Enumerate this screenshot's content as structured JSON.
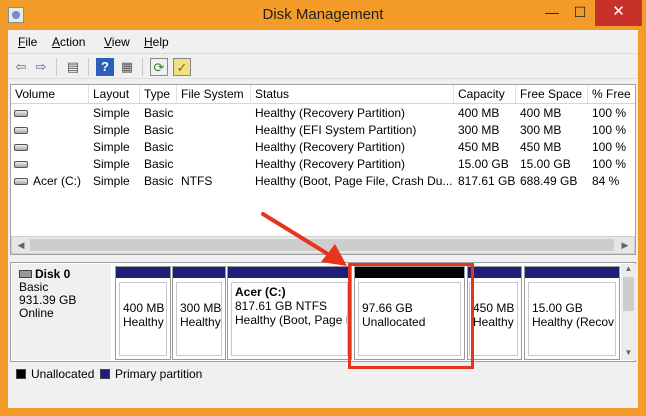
{
  "window": {
    "title": "Disk Management",
    "close_glyph": "✕",
    "max_glyph": "☐",
    "min_glyph": "—"
  },
  "menu": [
    {
      "key": "F",
      "rest": "ile"
    },
    {
      "key": "A",
      "rest": "ction"
    },
    {
      "key": "V",
      "rest": "iew"
    },
    {
      "key": "H",
      "rest": "elp"
    }
  ],
  "toolbar": {
    "back_icon": "back-arrow-icon",
    "forward_icon": "forward-arrow-icon",
    "back_glyph": "⇦",
    "forward_glyph": "⇨",
    "panel_glyph": "▤",
    "help_glyph": "?",
    "props_glyph": "▦",
    "refresh_glyph": "⟳",
    "check_glyph": "✓"
  },
  "columns": [
    "Volume",
    "Layout",
    "Type",
    "File System",
    "Status",
    "Capacity",
    "Free Space",
    "% Free"
  ],
  "volumes": [
    {
      "volume": "",
      "layout": "Simple",
      "type": "Basic",
      "fs": "",
      "status": "Healthy (Recovery Partition)",
      "capacity": "400 MB",
      "free": "400 MB",
      "pct": "100 %"
    },
    {
      "volume": "",
      "layout": "Simple",
      "type": "Basic",
      "fs": "",
      "status": "Healthy (EFI System Partition)",
      "capacity": "300 MB",
      "free": "300 MB",
      "pct": "100 %"
    },
    {
      "volume": "",
      "layout": "Simple",
      "type": "Basic",
      "fs": "",
      "status": "Healthy (Recovery Partition)",
      "capacity": "450 MB",
      "free": "450 MB",
      "pct": "100 %"
    },
    {
      "volume": "",
      "layout": "Simple",
      "type": "Basic",
      "fs": "",
      "status": "Healthy (Recovery Partition)",
      "capacity": "15.00 GB",
      "free": "15.00 GB",
      "pct": "100 %"
    },
    {
      "volume": "Acer (C:)",
      "layout": "Simple",
      "type": "Basic",
      "fs": "NTFS",
      "status": "Healthy (Boot, Page File, Crash Du...",
      "capacity": "817.61 GB",
      "free": "688.49 GB",
      "pct": "84 %"
    }
  ],
  "disk": {
    "name": "Disk 0",
    "type": "Basic",
    "size": "931.39 GB",
    "state": "Online"
  },
  "partitions": [
    {
      "line1": "400 MB",
      "line2": "Healthy",
      "title": "",
      "kind": "primary"
    },
    {
      "line1": "300 MB",
      "line2": "Healthy",
      "title": "",
      "kind": "primary"
    },
    {
      "title": "Acer  (C:)",
      "line1": "817.61 GB NTFS",
      "line2": "Healthy (Boot, Page F",
      "kind": "primary"
    },
    {
      "line1": "97.66 GB",
      "line2": "Unallocated",
      "title": "",
      "kind": "unallocated"
    },
    {
      "line1": "450 MB",
      "line2": "Healthy",
      "title": "",
      "kind": "primary"
    },
    {
      "line1": "15.00 GB",
      "line2": "Healthy (Recov",
      "title": "",
      "kind": "primary"
    }
  ],
  "legend": [
    {
      "label": "Unallocated",
      "color": "#000000"
    },
    {
      "label": "Primary partition",
      "color": "#1f1f7a"
    }
  ],
  "annotation": {
    "highlight_color": "#e8341c"
  }
}
